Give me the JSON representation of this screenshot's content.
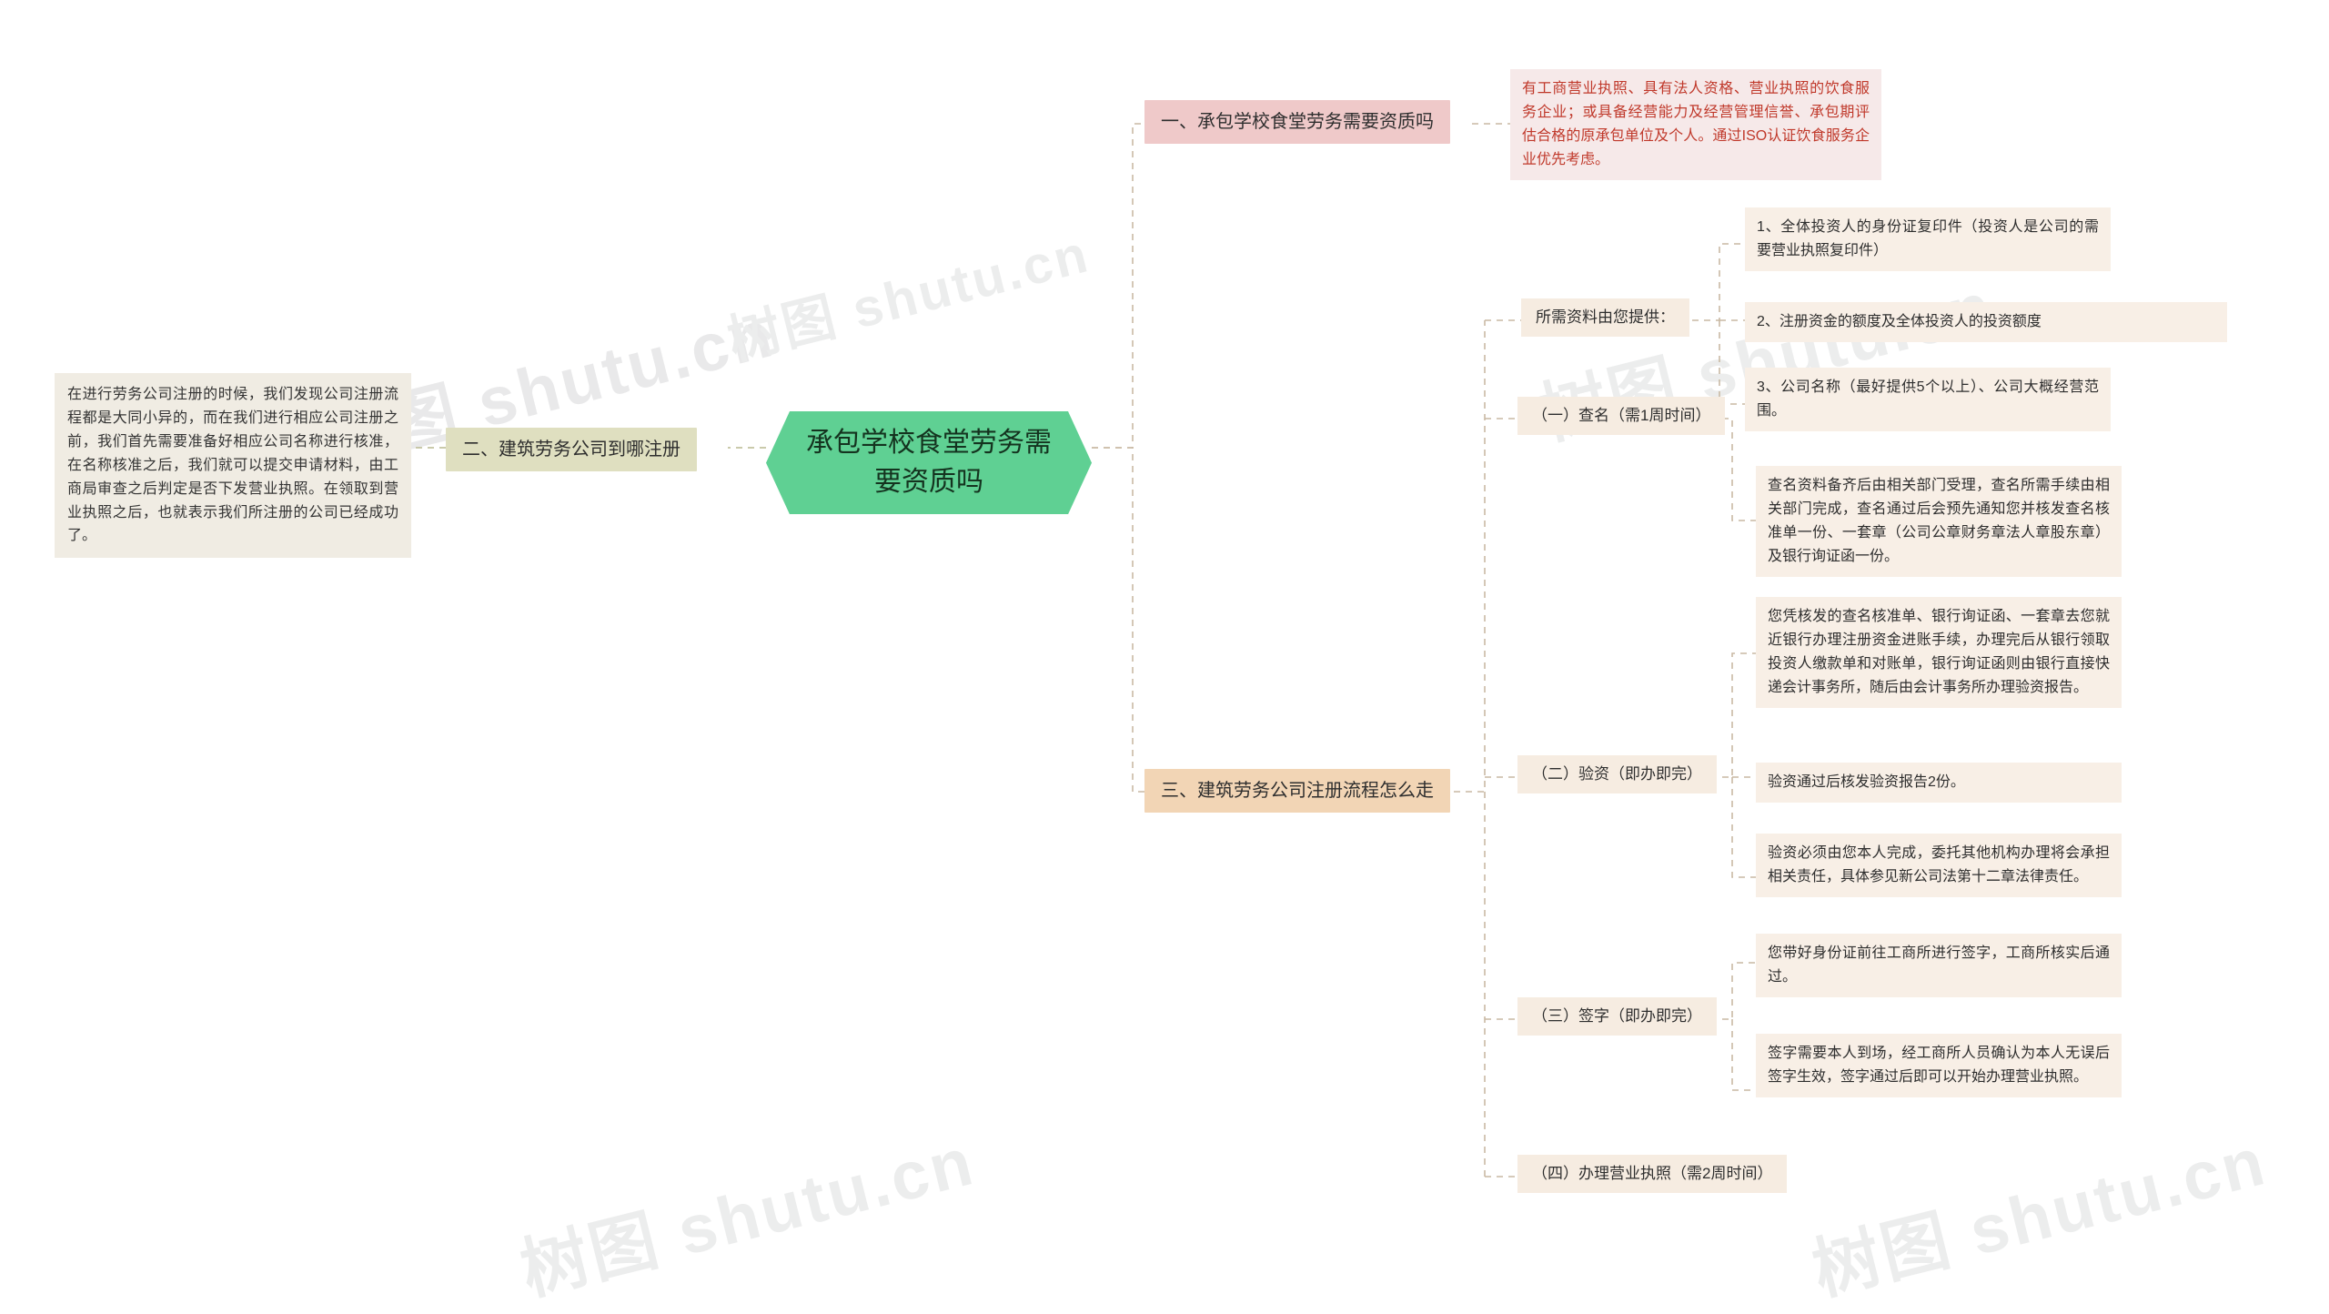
{
  "document": {
    "type": "mindmap",
    "central_topic": "承包学校食堂劳务需要资质吗",
    "watermark": "树图 shutu.cn"
  },
  "left_branch": {
    "intro_note": "在进行劳务公司注册的时候，我们发现公司注册流程都是大同小异的，而在我们进行相应公司注册之前，我们首先需要准备好相应公司名称进行核准，在名称核准之后，我们就可以提交申请材料，由工商局审查之后判定是否下发营业执照。在领取到营业执照之后，也就表示我们所注册的公司已经成功了。",
    "topic": "二、建筑劳务公司到哪注册"
  },
  "branch_one": {
    "title": "一、承包学校食堂劳务需要资质吗",
    "detail": "有工商营业执照、具有法人资格、营业执照的饮食服务企业；或具备经营能力及经营管理信誉、承包期评估合格的原承包单位及个人。通过ISO认证饮食服务企业优先考虑。"
  },
  "branch_three": {
    "title": "三、建筑劳务公司注册流程怎么走",
    "materials": {
      "label": "所需资料由您提供：",
      "items": [
        "1、全体投资人的身份证复印件（投资人是公司的需要营业执照复印件）",
        "2、注册资金的额度及全体投资人的投资额度",
        "3、公司名称（最好提供5个以上）、公司大概经营范围。"
      ]
    },
    "steps": [
      {
        "label": "（一）查名（需1周时间）",
        "details": [
          "查名资料备齐后由相关部门受理，查名所需手续由相关部门完成，查名通过后会预先通知您并核发查名核准单一份、一套章（公司公章财务章法人章股东章）及银行询证函一份。"
        ]
      },
      {
        "label": "（二）验资（即办即完）",
        "details": [
          "您凭核发的查名核准单、银行询证函、一套章去您就近银行办理注册资金进账手续，办理完后从银行领取投资人缴款单和对账单，银行询证函则由银行直接快递会计事务所，随后由会计事务所办理验资报告。",
          "验资通过后核发验资报告2份。",
          "验资必须由您本人完成，委托其他机构办理将会承担相关责任，具体参见新公司法第十二章法律责任。"
        ]
      },
      {
        "label": "（三）签字（即办即完）",
        "details": [
          "您带好身份证前往工商所进行签字，工商所核实后通过。",
          "签字需要本人到场，经工商所人员确认为本人无误后签字生效，签字通过后即可以开始办理营业执照。"
        ]
      },
      {
        "label": "（四）办理营业执照（需2周时间）",
        "details": []
      }
    ]
  },
  "colors": {
    "central": "#5fd093",
    "branch_one": "#efc9c9",
    "branch_two": "#dfdfc0",
    "branch_three": "#f2d5b5",
    "leaf": "#f8efe6",
    "red_text": "#c0392b"
  }
}
